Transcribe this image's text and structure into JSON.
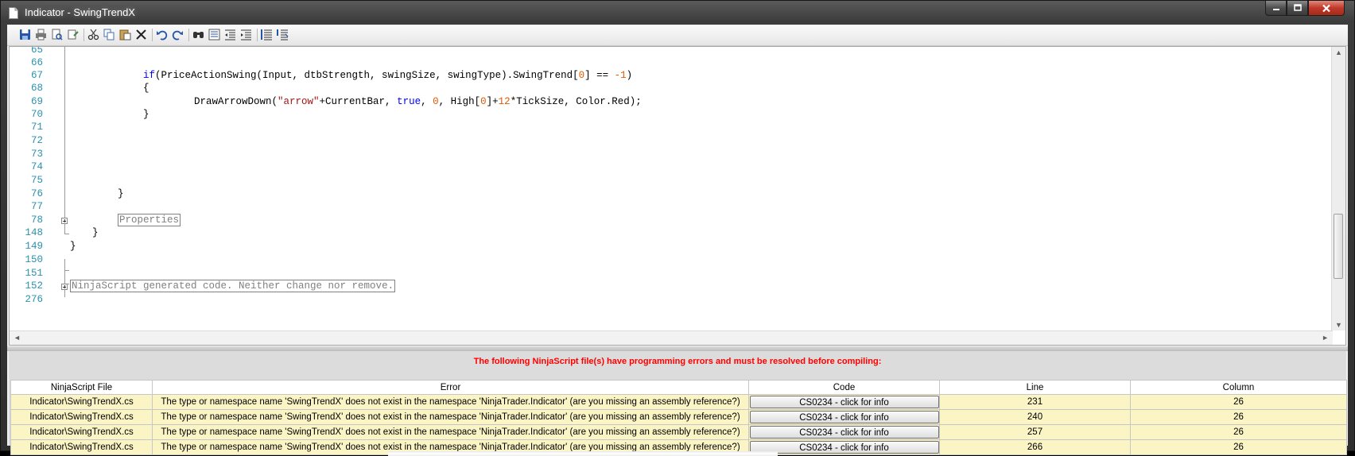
{
  "window": {
    "title": "Indicator - SwingTrendX"
  },
  "toolbar": {
    "icons": [
      "save-icon",
      "print-icon",
      "print-preview-icon",
      "page-setup-icon",
      "cut-icon",
      "copy-icon",
      "paste-icon",
      "delete-icon",
      "undo-icon",
      "redo-icon",
      "find-icon",
      "replace-icon",
      "outdent-icon",
      "indent-icon",
      "comment-icon",
      "uncomment-icon"
    ]
  },
  "editor": {
    "lines": [
      {
        "n": "65"
      },
      {
        "n": "66"
      },
      {
        "n": "67"
      },
      {
        "n": "68"
      },
      {
        "n": "69"
      },
      {
        "n": "70"
      },
      {
        "n": "71"
      },
      {
        "n": "72"
      },
      {
        "n": "73"
      },
      {
        "n": "74"
      },
      {
        "n": "75"
      },
      {
        "n": "76"
      },
      {
        "n": "77"
      },
      {
        "n": "78"
      },
      {
        "n": "148"
      },
      {
        "n": "149"
      },
      {
        "n": "150"
      },
      {
        "n": "151"
      },
      {
        "n": "152"
      },
      {
        "n": "276"
      }
    ],
    "code": {
      "l67_kw": "if",
      "l67_a": "(PriceActionSwing(Input, dtbStrength, swingSize, swingType).SwingTrend[",
      "l67_n0": "0",
      "l67_b": "] == ",
      "l67_n1": "-1",
      "l67_c": ")",
      "l68": "{",
      "l69_a": "DrawArrowDown(",
      "l69_str": "\"arrow\"",
      "l69_b": "+CurrentBar, ",
      "l69_kw": "true",
      "l69_c": ", ",
      "l69_n0": "0",
      "l69_d": ", High[",
      "l69_n1": "0",
      "l69_e": "]+",
      "l69_n2": "12",
      "l69_f": "*TickSize, Color.Red);",
      "l70": "}",
      "l76": "}",
      "l78": "Properties",
      "l148": "}",
      "l149": "}",
      "l152": "NinjaScript generated code. Neither change nor remove."
    }
  },
  "errors": {
    "message": "The following NinjaScript file(s) have programming errors and must be resolved before compiling:",
    "columns": [
      "NinjaScript File",
      "Error",
      "Code",
      "Line",
      "Column"
    ],
    "rows": [
      {
        "file": "Indicator\\SwingTrendX.cs",
        "error": "The type or namespace name 'SwingTrendX' does not exist in the namespace 'NinjaTrader.Indicator' (are you missing an assembly reference?)",
        "code": "CS0234 - click for info",
        "line": "231",
        "column": "26"
      },
      {
        "file": "Indicator\\SwingTrendX.cs",
        "error": "The type or namespace name 'SwingTrendX' does not exist in the namespace 'NinjaTrader.Indicator' (are you missing an assembly reference?)",
        "code": "CS0234 - click for info",
        "line": "240",
        "column": "26"
      },
      {
        "file": "Indicator\\SwingTrendX.cs",
        "error": "The type or namespace name 'SwingTrendX' does not exist in the namespace 'NinjaTrader.Indicator' (are you missing an assembly reference?)",
        "code": "CS0234 - click for info",
        "line": "257",
        "column": "26"
      },
      {
        "file": "Indicator\\SwingTrendX.cs",
        "error": "The type or namespace name 'SwingTrendX' does not exist in the namespace 'NinjaTrader.Indicator' (are you missing an assembly reference?)",
        "code": "CS0234 - click for info",
        "line": "266",
        "column": "26"
      }
    ]
  },
  "colors": {
    "error_text": "#ff0000",
    "row_bg": "#fbf4c4",
    "line_numbers": "#2b91af",
    "keyword": "#0000ff",
    "string": "#a31515"
  }
}
